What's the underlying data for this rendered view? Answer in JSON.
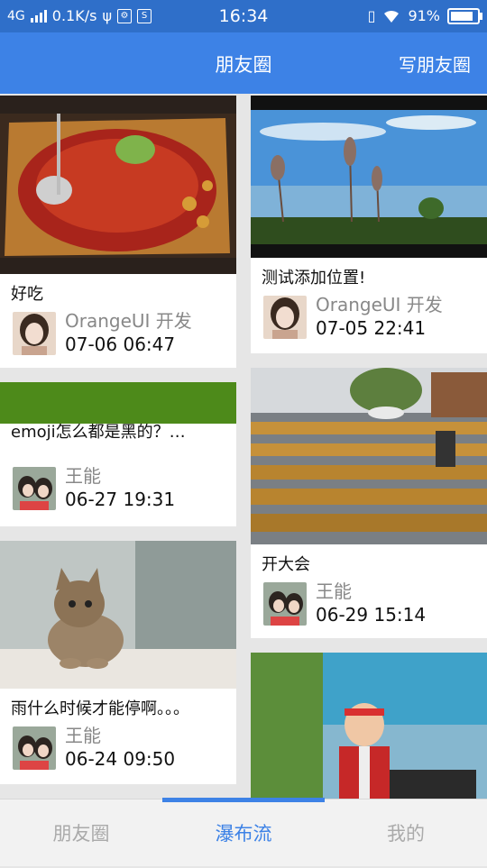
{
  "status_bar": {
    "network": "4G",
    "speed": "0.1K/s",
    "time": "16:34",
    "battery": "91%"
  },
  "header": {
    "title": "朋友圈",
    "action_label": "写朋友圈"
  },
  "feed": {
    "left": [
      {
        "caption": "好吃",
        "author": "OrangeUI 开发",
        "time": "07-06 06:47",
        "photo": "food-photo"
      },
      {
        "caption": "emoji怎么都是黑的？…",
        "author": "王能",
        "time": "06-27 19:31",
        "photo": "green-banner"
      },
      {
        "caption": "雨什么时候才能停啊。。。",
        "author": "王能",
        "time": "06-24 09:50",
        "photo": "cat-photo"
      }
    ],
    "right": [
      {
        "caption": "测试添加位置!",
        "author": "OrangeUI 开发",
        "time": "07-05 22:41",
        "photo": "seaside-photo"
      },
      {
        "caption": "开大会",
        "author": "王能",
        "time": "06-29 15:14",
        "photo": "bleachers-photo"
      }
    ]
  },
  "tabs": [
    {
      "label": "朋友圈",
      "active": false
    },
    {
      "label": "瀑布流",
      "active": true
    },
    {
      "label": "我的",
      "active": false
    }
  ],
  "colors": {
    "accent": "#3d82e6",
    "status_bar": "#2f6fc9",
    "banner_green": "#4d8a1a"
  }
}
